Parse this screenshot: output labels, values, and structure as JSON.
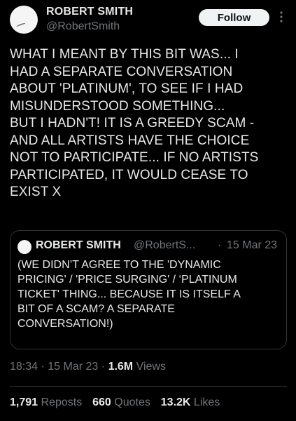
{
  "author": {
    "name": "ROBERT SMITH",
    "handle": "@RobertSmith"
  },
  "follow_label": "Follow",
  "tweet_text": "WHAT I MEANT BY THIS BIT WAS... I\nHAD A SEPARATE CONVERSATION\nABOUT 'PLATINUM', TO SEE IF I HAD\nMISUNDERSTOOD SOMETHING...\nBUT I HADN'T! IT IS A GREEDY SCAM -\nAND ALL ARTISTS HAVE THE CHOICE\nNOT TO PARTICIPATE... IF NO ARTISTS\nPARTICIPATED, IT WOULD CEASE TO\nEXIST X",
  "quote": {
    "name": "ROBERT SMITH",
    "handle": "@RobertS...",
    "separator": "·",
    "date": "15 Mar 23",
    "text": "(WE DIDN’T AGREE TO THE 'DYNAMIC\nPRICING' / 'PRICE SURGING' / ‘PLATINUM\nTICKET' THING... BECAUSE IT IS ITSELF A\nBIT OF A SCAM? A SEPARATE\nCONVERSATION!)"
  },
  "meta": {
    "time": "18:34",
    "date": "15 Mar 23",
    "views_count": "1.6M",
    "views_label": "Views"
  },
  "stats": {
    "reposts_count": "1,791",
    "reposts_label": "Reposts",
    "quotes_count": "660",
    "quotes_label": "Quotes",
    "likes_count": "13.2K",
    "likes_label": "Likes"
  },
  "icons": {
    "more": "more-vertical-icon"
  },
  "colors": {
    "background": "#000000",
    "text_primary": "#e7e9ea",
    "text_secondary": "#71767b",
    "border": "#2f3336",
    "follow_bg": "#eff3f4",
    "follow_text": "#0f1419"
  }
}
